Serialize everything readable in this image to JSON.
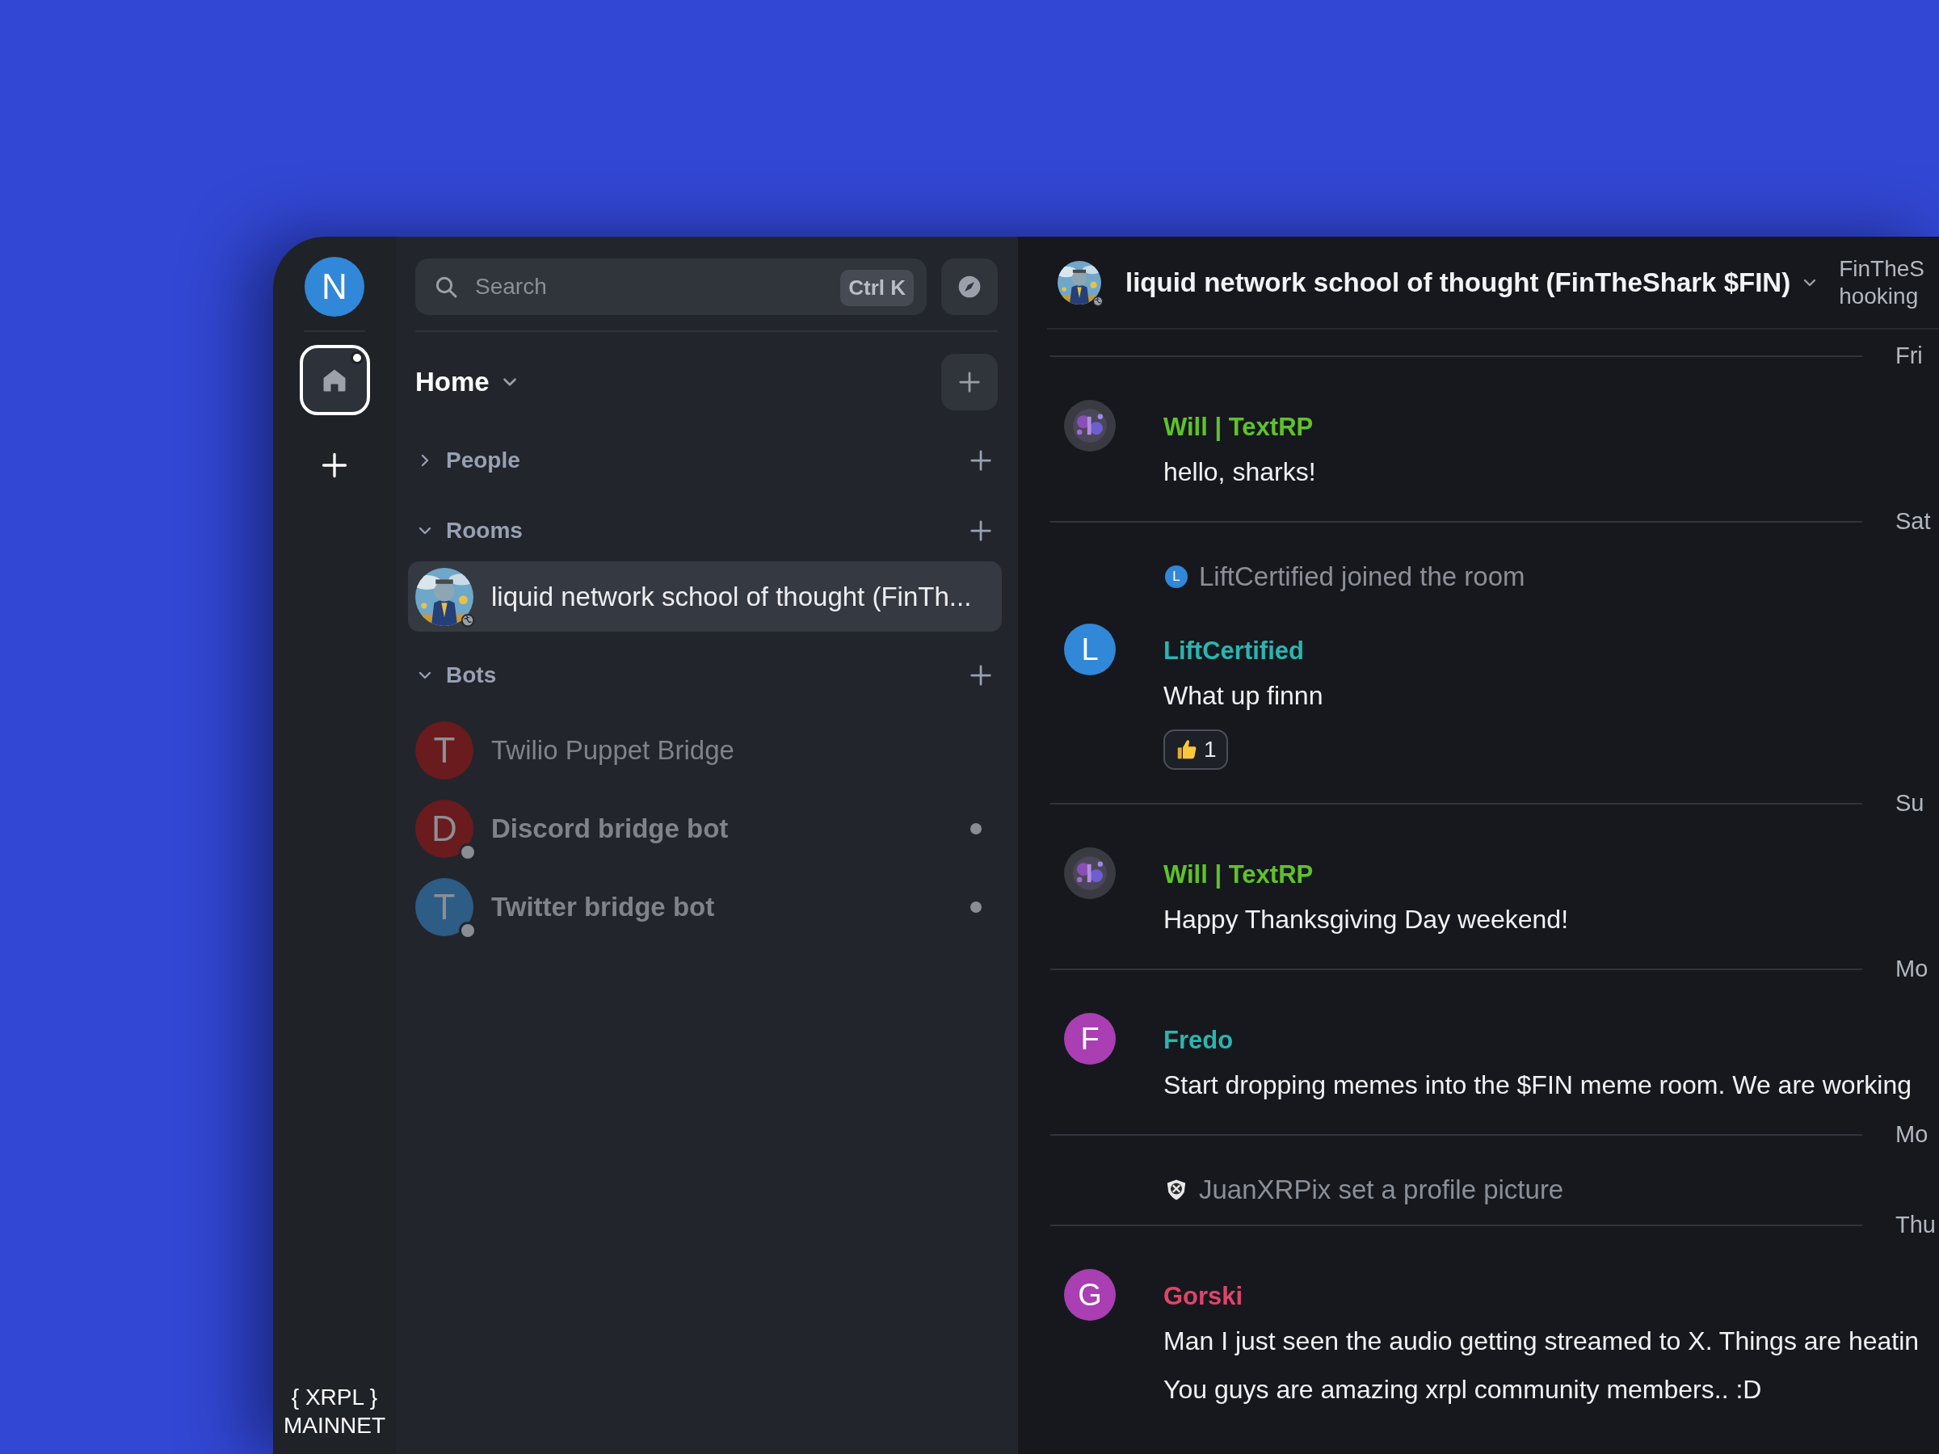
{
  "rail": {
    "account": {
      "initial": "N",
      "color": "#3187d8"
    },
    "home": {
      "selected": true,
      "unread": true
    },
    "footer": [
      "{ XRPL }",
      "MAINNET"
    ]
  },
  "sidebar": {
    "search": {
      "placeholder": "Search",
      "shortcut": "Ctrl K"
    },
    "title": "Home",
    "sections": [
      {
        "label": "People",
        "expanded": false
      },
      {
        "label": "Rooms",
        "expanded": true,
        "items": [
          {
            "name": "liquid network school of thought (FinTh...",
            "selected": true,
            "unread": false,
            "status": false,
            "avatar": {
              "kind": "picture"
            }
          }
        ]
      },
      {
        "label": "Bots",
        "expanded": true,
        "items": [
          {
            "name": "Twilio Puppet Bridge",
            "selected": false,
            "unread": false,
            "status": false,
            "avatar": {
              "kind": "initial",
              "initial": "T",
              "color": "#6a1b1d"
            }
          },
          {
            "name": "Discord bridge bot",
            "selected": false,
            "unread": true,
            "status": true,
            "avatar": {
              "kind": "initial",
              "initial": "D",
              "color": "#6a1b1d"
            }
          },
          {
            "name": "Twitter bridge bot",
            "selected": false,
            "unread": true,
            "status": true,
            "avatar": {
              "kind": "initial",
              "initial": "T",
              "color": "#2d5c85"
            }
          }
        ]
      }
    ]
  },
  "chat": {
    "header": {
      "title": "liquid network school of thought (FinTheShark $FIN)",
      "topic": [
        "FinTheS",
        "hooking"
      ]
    },
    "timeline": [
      {
        "kind": "divider",
        "label": "Fri"
      },
      {
        "kind": "message",
        "sender": "Will | TextRP",
        "color": "#5fc22a",
        "avatar": {
          "kind": "picture"
        },
        "lines": [
          "hello, sharks!"
        ]
      },
      {
        "kind": "divider",
        "label": "Sat"
      },
      {
        "kind": "event",
        "text": "LiftCertified joined the room",
        "icon": {
          "kind": "initial",
          "initial": "L",
          "color": "#3187d8"
        }
      },
      {
        "kind": "message",
        "sender": "LiftCertified",
        "color": "#2ab5b0",
        "avatar": {
          "kind": "initial",
          "initial": "L",
          "color": "#3187d8"
        },
        "lines": [
          "What up finnn"
        ],
        "reaction": {
          "count": "1"
        }
      },
      {
        "kind": "divider",
        "label": "Su"
      },
      {
        "kind": "message",
        "sender": "Will | TextRP",
        "color": "#5fc22a",
        "avatar": {
          "kind": "picture"
        },
        "lines": [
          "Happy Thanksgiving Day weekend!"
        ]
      },
      {
        "kind": "divider",
        "label": "Mo"
      },
      {
        "kind": "message",
        "sender": "Fredo",
        "color": "#2ab5b0",
        "avatar": {
          "kind": "initial",
          "initial": "F",
          "color": "#a93fb3"
        },
        "lines": [
          "Start dropping memes into the $FIN meme room. We are working"
        ]
      },
      {
        "kind": "divider",
        "label": "Mo"
      },
      {
        "kind": "event",
        "text": "JuanXRPix set a profile picture",
        "icon": {
          "kind": "picture"
        }
      },
      {
        "kind": "divider",
        "label": "Thu"
      },
      {
        "kind": "message",
        "sender": "Gorski",
        "color": "#e0446b",
        "avatar": {
          "kind": "initial",
          "initial": "G",
          "color": "#a93fb3"
        },
        "lines": [
          "Man I just seen the audio getting streamed to X. Things are heatin",
          "You guys are amazing xrpl community members.. :D"
        ]
      }
    ]
  }
}
